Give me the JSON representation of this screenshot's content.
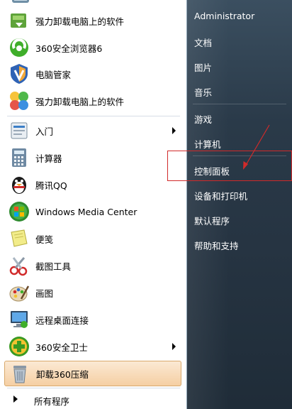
{
  "left_items": [
    {
      "label": "强力卸载电脑上的软件",
      "icon": "uninstall-box-icon"
    },
    {
      "label": "360安全浏览器6",
      "icon": "360-browser-icon"
    },
    {
      "label": "电脑管家",
      "icon": "shield-v-icon"
    },
    {
      "label": "强力卸载电脑上的软件",
      "icon": "butterfly-icon"
    },
    {
      "label": "入门",
      "icon": "getting-started-icon"
    },
    {
      "label": "计算器",
      "icon": "calculator-icon"
    },
    {
      "label": "腾讯QQ",
      "icon": "qq-penguin-icon"
    },
    {
      "label": "Windows Media Center",
      "icon": "windows-logo-icon"
    },
    {
      "label": "便笺",
      "icon": "sticky-note-icon"
    },
    {
      "label": "截图工具",
      "icon": "scissors-icon"
    },
    {
      "label": "画图",
      "icon": "paint-palette-icon"
    },
    {
      "label": "远程桌面连接",
      "icon": "remote-desktop-icon"
    },
    {
      "label": "360安全卫士",
      "icon": "360-guard-icon"
    },
    {
      "label": "卸载360压缩",
      "icon": "trash-bin-icon"
    }
  ],
  "all_programs": "所有程序",
  "right_items": [
    {
      "label": "Administrator"
    },
    {
      "label": "文档"
    },
    {
      "label": "图片"
    },
    {
      "label": "音乐"
    },
    {
      "label": "游戏"
    },
    {
      "label": "计算机"
    },
    {
      "label": "控制面板"
    },
    {
      "label": "设备和打印机"
    },
    {
      "label": "默认程序"
    },
    {
      "label": "帮助和支持"
    }
  ],
  "colors": {
    "highlight_box": "#d12a2a",
    "arrow": "#d12a2a",
    "selected_item_bg": "#f5cfa3"
  }
}
